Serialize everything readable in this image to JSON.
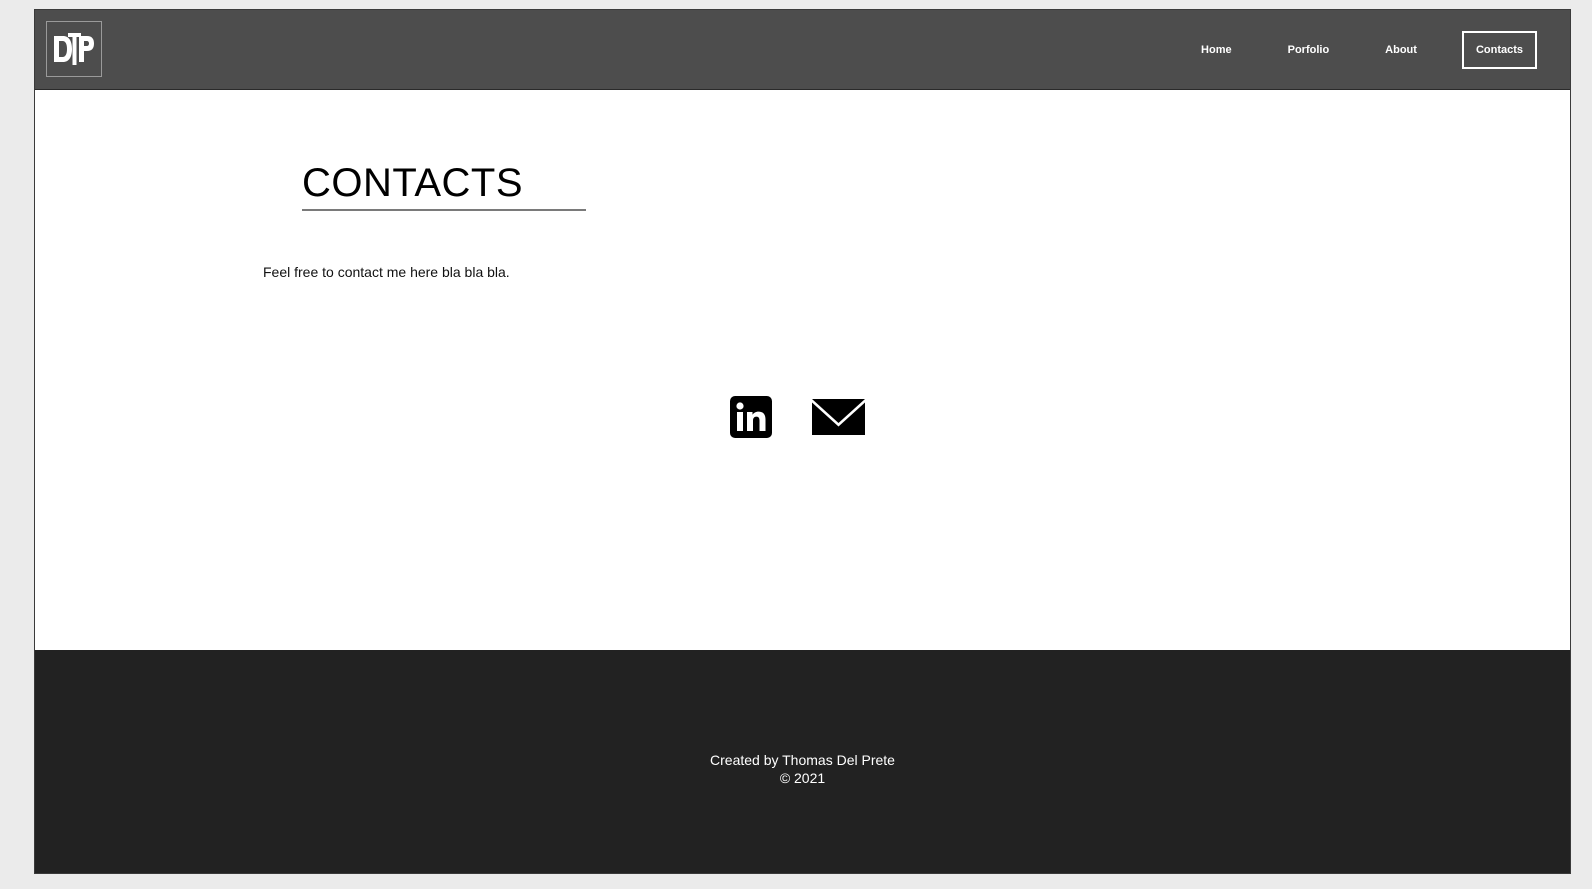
{
  "header": {
    "logo_icon": "dtp-monogram-logo",
    "nav": [
      {
        "label": "Home"
      },
      {
        "label": "Porfolio"
      },
      {
        "label": "About"
      },
      {
        "label": "Contacts",
        "active": true
      }
    ]
  },
  "main": {
    "title": "CONTACTS",
    "intro": "Feel free to contact me here bla bla bla.",
    "socials": [
      {
        "icon": "linkedin-icon"
      },
      {
        "icon": "mail-icon"
      }
    ]
  },
  "footer": {
    "credit": "Created by Thomas Del Prete",
    "copyright": "© 2021"
  },
  "colors": {
    "page_bg": "#ebebeb",
    "header_bg": "#4d4d4d",
    "footer_bg": "#222222",
    "content_bg": "#ffffff"
  }
}
